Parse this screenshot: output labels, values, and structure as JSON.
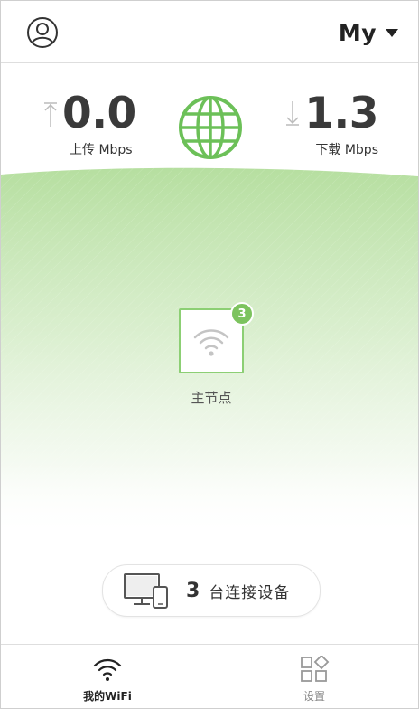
{
  "header": {
    "network_name": "My",
    "profile_icon": "user-circle-icon",
    "dropdown_icon": "caret-down-icon"
  },
  "speed": {
    "upload": {
      "value": "0.0",
      "label": "上传 Mbps",
      "icon": "upload-arrow-icon"
    },
    "download": {
      "value": "1.3",
      "label": "下载 Mbps",
      "icon": "download-arrow-icon"
    },
    "internet_icon": "globe-icon"
  },
  "topology": {
    "node_label": "主节点",
    "node_badge": "3",
    "node_icon": "wifi-icon"
  },
  "devices": {
    "count": "3",
    "label": "台连接设备",
    "icon": "monitor-phone-icon"
  },
  "tabbar": {
    "wifi_label": "我的WiFi",
    "settings_label": "设置"
  },
  "colors": {
    "accent_green": "#7cc35e",
    "globe_green": "#6cc058",
    "text_dark": "#333333",
    "tab_inactive": "#888888"
  }
}
